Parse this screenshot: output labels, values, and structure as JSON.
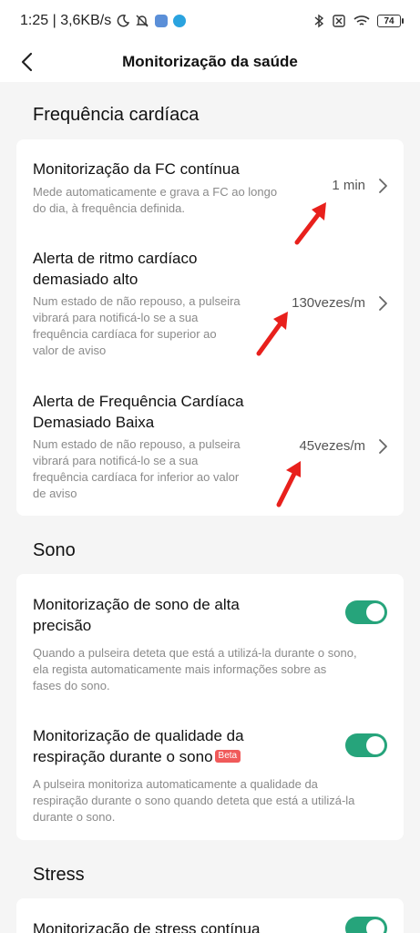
{
  "status_bar": {
    "time_speed": "1:25 | 3,6KB/s",
    "battery": "74"
  },
  "header": {
    "title": "Monitorização da saúde"
  },
  "heart_rate": {
    "section_title": "Frequência cardíaca",
    "items": [
      {
        "title": "Monitorização da FC contínua",
        "desc_lines": [
          "Mede automaticamente e grava a FC ao longo",
          "do dia, à frequência definida."
        ],
        "value": "1 min"
      },
      {
        "title_lines": [
          "Alerta de ritmo cardíaco",
          "demasiado alto"
        ],
        "desc_lines": [
          "Num estado de não repouso, a pulseira",
          "vibrará para notificá-lo se a sua",
          "frequência cardíaca for superior ao",
          "valor de aviso"
        ],
        "value": "130vezes/m"
      },
      {
        "title_lines": [
          "Alerta de Frequência Cardíaca",
          "Demasiado Baixa"
        ],
        "desc_lines": [
          "Num estado de não repouso, a pulseira",
          "vibrará para notificá-lo se a sua",
          "frequência cardíaca for inferior ao valor",
          "de aviso"
        ],
        "value": "45vezes/m"
      }
    ]
  },
  "sleep": {
    "section_title": "Sono",
    "items": [
      {
        "title_lines": [
          "Monitorização de sono de alta",
          "precisão"
        ],
        "desc_lines": [
          "Quando a pulseira deteta que está a utilizá-la durante o sono,",
          "ela regista automaticamente mais informações sobre as",
          "fases do sono."
        ],
        "enabled": true
      },
      {
        "title_lines": [
          "Monitorização de qualidade da",
          "respiração durante o sono"
        ],
        "badge": "Beta",
        "desc_lines": [
          "A pulseira monitoriza automaticamente a qualidade da",
          "respiração durante o sono quando deteta que está a utilizá-la",
          "durante o sono."
        ],
        "enabled": true
      }
    ]
  },
  "stress": {
    "section_title": "Stress",
    "items": [
      {
        "title": "Monitorização de stress contínua",
        "enabled": true
      }
    ]
  },
  "colors": {
    "toggle_on": "#26a47b",
    "arrow_red": "#e8201c",
    "beta_badge": "#f05a5a"
  }
}
